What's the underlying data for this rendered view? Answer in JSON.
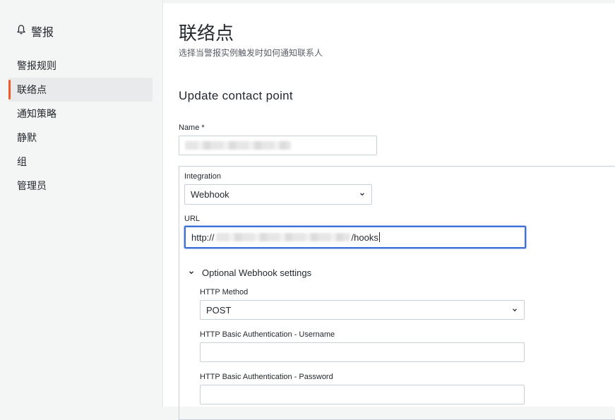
{
  "sidebar": {
    "header": {
      "icon": "bell-icon",
      "label": "警报"
    },
    "items": [
      {
        "label": "警报规则",
        "active": false
      },
      {
        "label": "联络点",
        "active": true
      },
      {
        "label": "通知策略",
        "active": false
      },
      {
        "label": "静默",
        "active": false
      },
      {
        "label": "组",
        "active": false
      },
      {
        "label": "管理员",
        "active": false
      }
    ]
  },
  "page": {
    "title": "联络点",
    "subtitle": "选择当警报实例触发时如何通知联系人",
    "form_title": "Update contact point"
  },
  "form": {
    "name_label": "Name *",
    "name_value": "",
    "integration_label": "Integration",
    "integration_value": "Webhook",
    "url_label": "URL",
    "url_prefix": "http://",
    "url_suffix": "/hooks",
    "optional_section_label": "Optional Webhook settings",
    "http_method_label": "HTTP Method",
    "http_method_value": "POST",
    "basic_user_label": "HTTP Basic Authentication - Username",
    "basic_user_value": "",
    "basic_pass_label": "HTTP Basic Authentication - Password",
    "basic_pass_value": ""
  },
  "colors": {
    "accent": "#f05a28",
    "focus": "#3d71d9"
  }
}
